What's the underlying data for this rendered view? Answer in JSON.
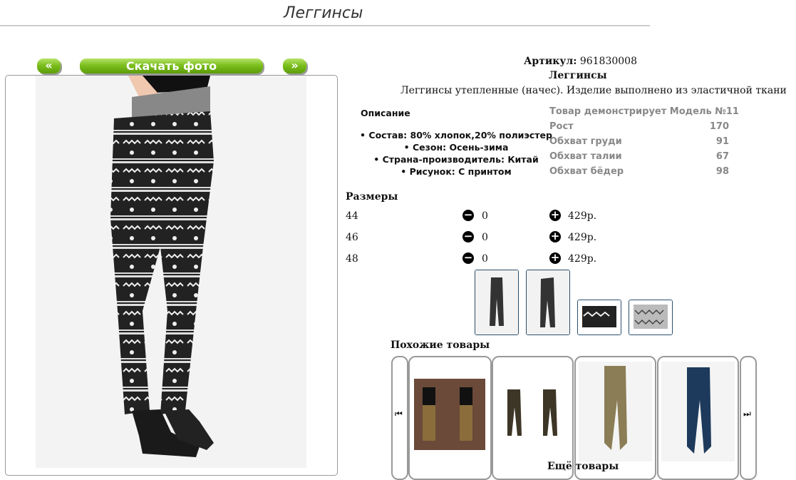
{
  "page": {
    "title": "Леггинсы"
  },
  "gallery": {
    "prev_label": "«",
    "next_label": "»",
    "download_label": "Скачать фото"
  },
  "product": {
    "article_label": "Артикул:",
    "article_value": "961830008",
    "name": "Леггинсы",
    "summary": "Леггинсы утепленные (начес). Изделие выполнено из эластичной ткани",
    "description_heading": "Описание",
    "description": [
      "Состав: 80% хлопок,20% полиэстер",
      "Сезон: Осень-зима",
      "Страна-производитель: Китай",
      "Рисунок: С принтом"
    ]
  },
  "model": {
    "heading": "Товар демонстрирует Модель №11",
    "rows": [
      {
        "label": "Рост",
        "value": "170"
      },
      {
        "label": "Обхват груди",
        "value": "91"
      },
      {
        "label": "Обхват талии",
        "value": "67"
      },
      {
        "label": "Обхват бёдер",
        "value": "98"
      }
    ]
  },
  "sizes": {
    "heading": "Размеры",
    "rows": [
      {
        "size": "44",
        "qty": "0",
        "price": "429р."
      },
      {
        "size": "46",
        "qty": "0",
        "price": "429р."
      },
      {
        "size": "48",
        "qty": "0",
        "price": "429р."
      }
    ],
    "minus_glyph": "−",
    "plus_glyph": "+"
  },
  "similar": {
    "heading": "Похожие товары",
    "prev_glyph": "⏮",
    "next_glyph": "⏭"
  },
  "more": {
    "heading_partial": "Ещё товары"
  },
  "colors": {
    "accent_green": "#7cbf1e",
    "thumb_border": "#2a4f6e"
  }
}
